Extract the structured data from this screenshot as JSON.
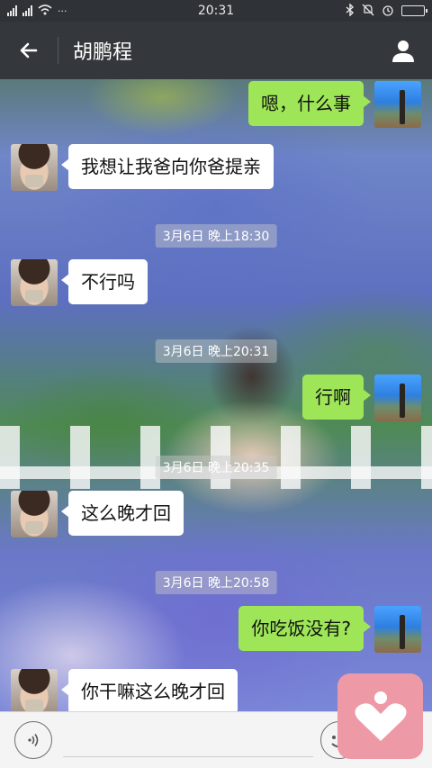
{
  "status_bar": {
    "left": "2G .ıl 2G .ıl",
    "time": "20:31"
  },
  "header": {
    "title": "胡鹏程"
  },
  "messages": [
    {
      "side": "right",
      "text": "嗯，什么事"
    },
    {
      "side": "left",
      "text": "我想让我爸向你爸提亲"
    },
    {
      "timestamp": "3月6日 晚上18:30"
    },
    {
      "side": "left",
      "text": "不行吗"
    },
    {
      "timestamp": "3月6日 晚上20:31"
    },
    {
      "side": "right",
      "text": "行啊"
    },
    {
      "timestamp": "3月6日 晚上20:35"
    },
    {
      "side": "left",
      "text": "这么晚才回"
    },
    {
      "timestamp": "3月6日 晚上20:58"
    },
    {
      "side": "right",
      "text": "你吃饭没有?"
    },
    {
      "side": "left",
      "text": "你干嘛这么晚才回"
    }
  ],
  "input": {
    "placeholder": ""
  },
  "colors": {
    "outgoing_bubble": "#9ee658",
    "incoming_bubble": "#ffffff",
    "title_bar": "#34373b",
    "floating_widget": "#ee9aa6"
  },
  "icons": [
    "back-arrow-icon",
    "profile-icon",
    "voice-icon",
    "emoji-icon",
    "heart-icon",
    "bluetooth-icon",
    "alarm-icon",
    "battery-icon",
    "wifi-icon"
  ]
}
